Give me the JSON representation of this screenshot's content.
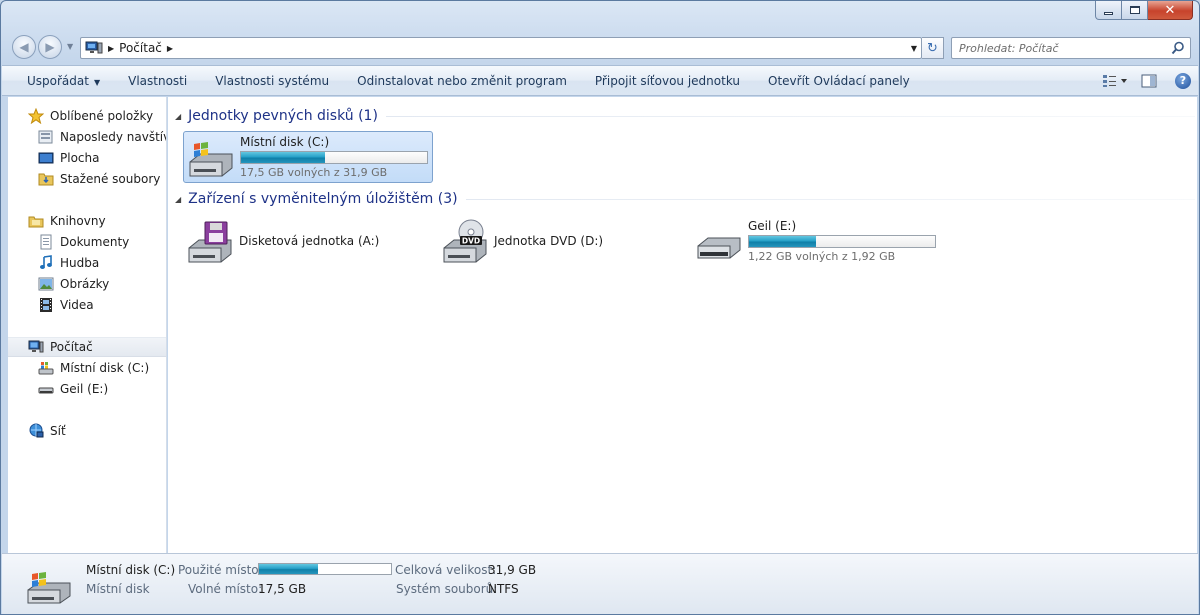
{
  "window": {
    "caption": {
      "minimize": "",
      "maximize": "",
      "close": "✕"
    }
  },
  "address": {
    "path": "Počítač",
    "search_placeholder": "Prohledat: Počítač"
  },
  "toolbar": {
    "commands": [
      {
        "label": "Uspořádat",
        "has_menu": true
      },
      {
        "label": "Vlastnosti"
      },
      {
        "label": "Vlastnosti systému"
      },
      {
        "label": "Odinstalovat nebo změnit program"
      },
      {
        "label": "Připojit síťovou jednotku"
      },
      {
        "label": "Otevřít Ovládací panely"
      }
    ]
  },
  "sidebar": {
    "favorites": "Oblíbené položky",
    "recent": "Naposledy navštívené",
    "desktop": "Plocha",
    "downloads": "Stažené soubory",
    "libraries": "Knihovny",
    "documents": "Dokumenty",
    "music": "Hudba",
    "pictures": "Obrázky",
    "videos": "Videa",
    "computer": "Počítač",
    "local_disk": "Místní disk (C:)",
    "geil": "Geil (E:)",
    "network": "Síť"
  },
  "groups": {
    "hard_disks": "Jednotky pevných disků (1)",
    "removable": "Zařízení s vyměnitelným úložištěm (3)"
  },
  "drives": {
    "c": {
      "name": "Místní disk (C:)",
      "free_text": "17,5 GB volných z 31,9 GB",
      "used_fraction": 0.45
    },
    "a": {
      "name": "Disketová jednotka (A:)"
    },
    "d": {
      "name": "Jednotka DVD (D:)",
      "badge": "DVD"
    },
    "e": {
      "name": "Geil (E:)",
      "free_text": "1,22 GB volných z 1,92 GB",
      "used_fraction": 0.36
    }
  },
  "details": {
    "title": "Místní disk (C:)",
    "type": "Místní disk",
    "used_label": "Použité místo:",
    "free_label": "Volné místo:",
    "free_value": "17,5 GB",
    "total_label": "Celková velikost:",
    "total_value": "31,9 GB",
    "fs_label": "Systém souborů:",
    "fs_value": "NTFS",
    "used_fraction": 0.45
  },
  "colors": {
    "accent": "#1e3287",
    "bar": "#26a0c8"
  }
}
